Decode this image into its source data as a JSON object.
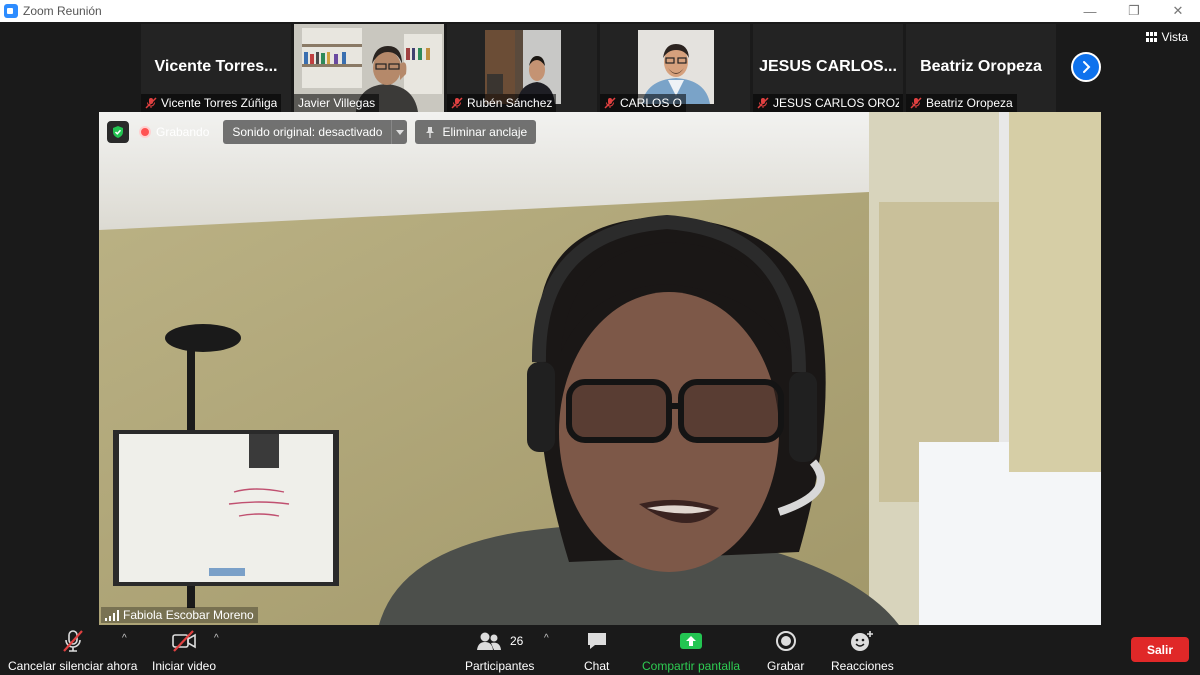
{
  "window": {
    "title": "Zoom Reunión",
    "controls": [
      "—",
      "❐",
      "✕"
    ]
  },
  "view_button": {
    "label": "Vista"
  },
  "participants_strip": [
    {
      "display": "Vicente  Torres...",
      "name": "Vicente Torres Zúñiga",
      "muted": true,
      "video": false
    },
    {
      "display": "",
      "name": "Javier Villegas",
      "muted": false,
      "video": true
    },
    {
      "display": "",
      "name": "Rubén Sánchez",
      "muted": true,
      "video": true
    },
    {
      "display": "",
      "name": "CARLOS O",
      "muted": true,
      "video": true
    },
    {
      "display": "JESUS  CARLOS...",
      "name": "JESUS CARLOS OROZC...",
      "muted": true,
      "video": false
    },
    {
      "display": "Beatriz Oropeza",
      "name": "Beatriz Oropeza",
      "muted": true,
      "video": false
    }
  ],
  "meeting_bar": {
    "recording_label": "Grabando",
    "original_sound_label": "Sonido original: desactivado",
    "unpin_label": "Eliminar anclaje"
  },
  "active_speaker": {
    "name": "Fabiola Escobar Moreno"
  },
  "toolbar": {
    "unmute_label": "Cancelar silenciar ahora",
    "start_video_label": "Iniciar video",
    "participants_label": "Participantes",
    "participants_count": "26",
    "chat_label": "Chat",
    "share_label": "Compartir pantalla",
    "record_label": "Grabar",
    "reactions_label": "Reacciones",
    "leave_label": "Salir"
  },
  "colors": {
    "accent": "#0e72ed",
    "leave": "#e02828",
    "share": "#2ecc52",
    "mute": "#e04040"
  }
}
